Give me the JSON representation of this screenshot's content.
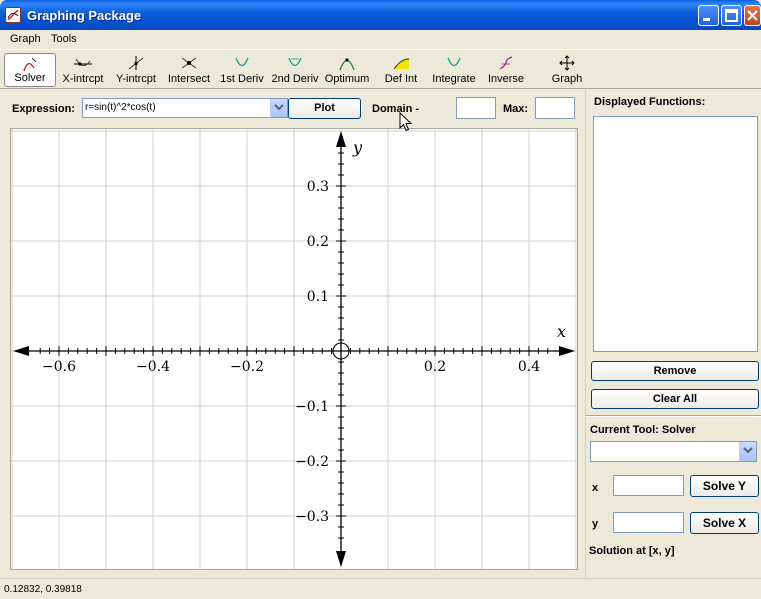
{
  "window": {
    "title": "Graphing Package"
  },
  "menu": [
    {
      "label": "Graph"
    },
    {
      "label": "Tools"
    }
  ],
  "toolbar": [
    {
      "label": "Solver",
      "icon": "solver-icon"
    },
    {
      "label": "X-intrcpt",
      "icon": "x-intercept-icon"
    },
    {
      "label": "Y-intrcpt",
      "icon": "y-intercept-icon"
    },
    {
      "label": "Intersect",
      "icon": "intersect-icon"
    },
    {
      "label": "1st Deriv",
      "icon": "first-derivative-icon"
    },
    {
      "label": "2nd Deriv",
      "icon": "second-derivative-icon"
    },
    {
      "label": "Optimum",
      "icon": "optimum-icon"
    },
    {
      "label": "Def Int",
      "icon": "definite-integral-icon"
    },
    {
      "label": "Integrate",
      "icon": "integrate-icon"
    },
    {
      "label": "Inverse",
      "icon": "inverse-icon"
    },
    {
      "label": "Graph",
      "icon": "graph-move-icon"
    }
  ],
  "expression": {
    "label": "Expression:",
    "value": "r=sin(t)^2*cos(t)",
    "plot_label": "Plot",
    "domain_label": "Domain -",
    "min_value": "",
    "max_label": "Max:",
    "max_value": ""
  },
  "graph": {
    "x_axis_label": "x",
    "y_axis_label": "y",
    "x_range": [
      -0.7,
      0.5
    ],
    "y_range": [
      -0.4,
      0.38
    ],
    "x_ticks": [
      {
        "value": -0.6,
        "label": "−0.6"
      },
      {
        "value": -0.4,
        "label": "−0.4"
      },
      {
        "value": -0.2,
        "label": "−0.2"
      },
      {
        "value": 0.2,
        "label": "0.2"
      },
      {
        "value": 0.4,
        "label": "0.4"
      }
    ],
    "y_ticks": [
      {
        "value": 0.3,
        "label": "0.3"
      },
      {
        "value": 0.2,
        "label": "0.2"
      },
      {
        "value": 0.1,
        "label": "0.1"
      },
      {
        "value": -0.1,
        "label": "−0.1"
      },
      {
        "value": -0.2,
        "label": "−0.2"
      },
      {
        "value": -0.3,
        "label": "−0.3"
      }
    ],
    "grid": true
  },
  "panel": {
    "displayed_functions_label": "Displayed Functions:",
    "remove_label": "Remove",
    "clear_all_label": "Clear All",
    "current_tool_label": "Current Tool: Solver",
    "tool_option_value": "",
    "x_label": "x",
    "x_value": "",
    "solve_y_label": "Solve Y",
    "y_label": "y",
    "y_value": "",
    "solve_x_label": "Solve X",
    "solution_label": "Solution at [x, y]"
  },
  "status": {
    "coords": "0.12832, 0.39818"
  },
  "colors": {
    "titlebar": "#0A5BDB",
    "accent": "#7f9db9"
  }
}
